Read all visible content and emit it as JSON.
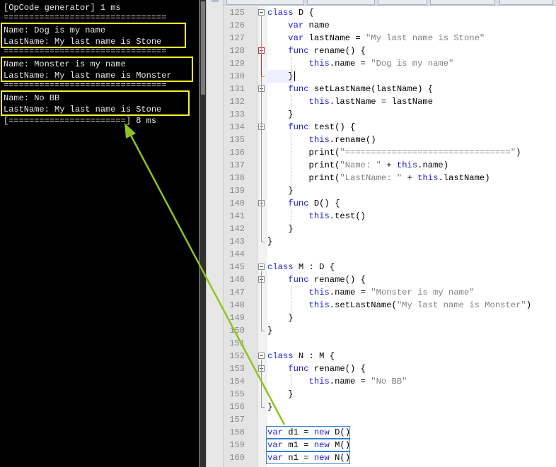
{
  "console": {
    "lines": [
      "[OpCode generator] 1 ms",
      "================================",
      "Name: Dog is my name",
      "LastName: My last name is Stone",
      "================================",
      "Name: Monster is my name",
      "LastName: My last name is Monster",
      "================================",
      "Name: No BB",
      "LastName: My last name is Stone",
      "[=======================] 8 ms"
    ]
  },
  "editor": {
    "lines": [
      {
        "n": "125",
        "t": "class D {"
      },
      {
        "n": "126",
        "t": "    var name"
      },
      {
        "n": "127",
        "t": "    var lastName = \"My last name is Stone\""
      },
      {
        "n": "128",
        "t": "    func rename() {"
      },
      {
        "n": "129",
        "t": "        this.name = \"Dog is my name\""
      },
      {
        "n": "130",
        "t": "    }"
      },
      {
        "n": "131",
        "t": "    func setLastName(lastName) {"
      },
      {
        "n": "132",
        "t": "        this.lastName = lastName"
      },
      {
        "n": "133",
        "t": "    }"
      },
      {
        "n": "134",
        "t": "    func test() {"
      },
      {
        "n": "135",
        "t": "        this.rename()"
      },
      {
        "n": "136",
        "t": "        print(\"================================\")"
      },
      {
        "n": "137",
        "t": "        print(\"Name: \" + this.name)"
      },
      {
        "n": "138",
        "t": "        print(\"LastName: \" + this.lastName)"
      },
      {
        "n": "139",
        "t": "    }"
      },
      {
        "n": "140",
        "t": "    func D() {"
      },
      {
        "n": "141",
        "t": "        this.test()"
      },
      {
        "n": "142",
        "t": "    }"
      },
      {
        "n": "143",
        "t": "}"
      },
      {
        "n": "144",
        "t": ""
      },
      {
        "n": "145",
        "t": "class M : D {"
      },
      {
        "n": "146",
        "t": "    func rename() {"
      },
      {
        "n": "147",
        "t": "        this.name = \"Monster is my name\""
      },
      {
        "n": "148",
        "t": "        this.setLastName(\"My last name is Monster\")"
      },
      {
        "n": "149",
        "t": "    }"
      },
      {
        "n": "150",
        "t": "}"
      },
      {
        "n": "151",
        "t": ""
      },
      {
        "n": "152",
        "t": "class N : M {"
      },
      {
        "n": "153",
        "t": "    func rename() {"
      },
      {
        "n": "154",
        "t": "        this.name = \"No BB\""
      },
      {
        "n": "155",
        "t": "    }"
      },
      {
        "n": "156",
        "t": "}"
      },
      {
        "n": "157",
        "t": ""
      },
      {
        "n": "158",
        "t": "var d1 = new D()"
      },
      {
        "n": "159",
        "t": "var m1 = new M()"
      },
      {
        "n": "160",
        "t": "var n1 = new N()"
      }
    ]
  },
  "colors": {
    "keyword": "#1d1ddc",
    "string": "#808080",
    "highlight_box": "#f7f12a",
    "arrow": "#8fc31f",
    "code_box": "#3b80c8"
  },
  "icons": [
    "fold-minus-icon",
    "arrow-annotation"
  ]
}
